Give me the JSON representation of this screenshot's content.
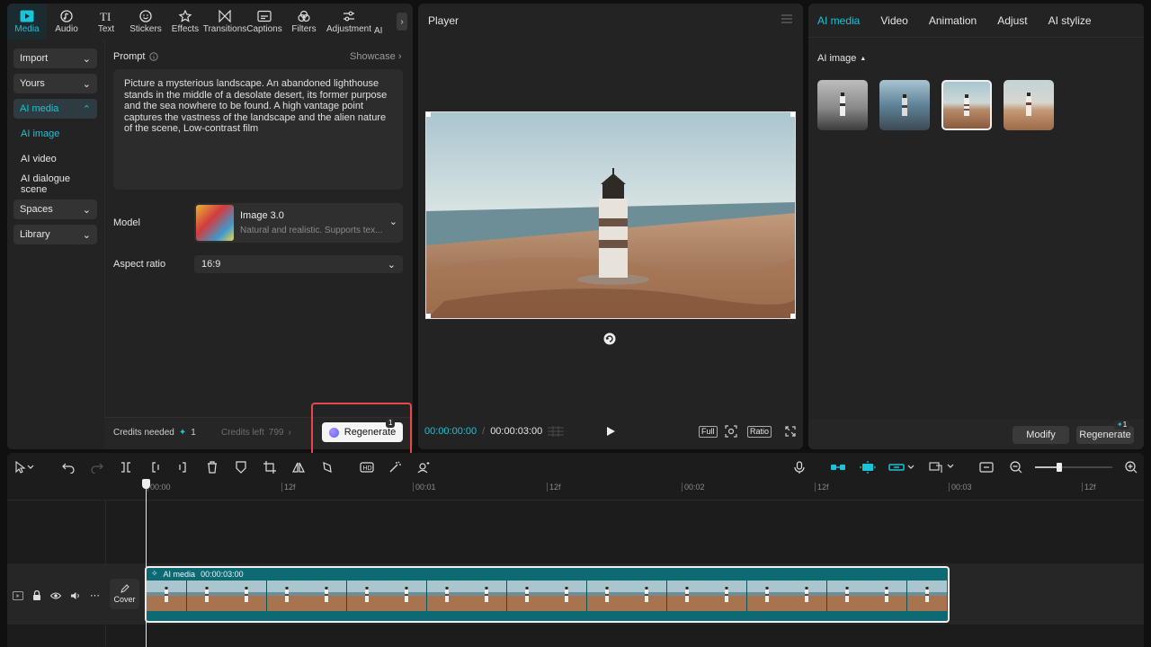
{
  "left_nav": {
    "items": [
      {
        "label": "Media",
        "icon": "media-icon",
        "active": true
      },
      {
        "label": "Audio",
        "icon": "audio-icon"
      },
      {
        "label": "Text",
        "icon": "text-icon"
      },
      {
        "label": "Stickers",
        "icon": "stickers-icon"
      },
      {
        "label": "Effects",
        "icon": "effects-icon"
      },
      {
        "label": "Transitions",
        "icon": "transitions-icon"
      },
      {
        "label": "Captions",
        "icon": "captions-icon"
      },
      {
        "label": "Filters",
        "icon": "filters-icon"
      },
      {
        "label": "Adjustment",
        "icon": "adjustment-icon"
      }
    ],
    "overflow_label": "AI"
  },
  "side_menu": {
    "import": "Import",
    "yours": "Yours",
    "ai_media": "AI media",
    "ai_image": "AI image",
    "ai_video": "AI video",
    "ai_dialogue": "AI dialogue scene",
    "spaces": "Spaces",
    "library": "Library"
  },
  "prompt": {
    "label": "Prompt",
    "showcase": "Showcase",
    "text": "Picture a mysterious landscape. An abandoned lighthouse stands in the middle of a desolate desert, its former purpose and the sea nowhere to be found. A high vantage point captures the vastness of the landscape and the alien nature of the scene, Low-contrast film"
  },
  "model": {
    "label": "Model",
    "name": "Image 3.0",
    "desc": "Natural and realistic. Supports tex..."
  },
  "aspect": {
    "label": "Aspect ratio",
    "value": "16:9"
  },
  "credits": {
    "needed_label": "Credits needed",
    "needed_value": "1",
    "left_label": "Credits left",
    "left_value": "799"
  },
  "regenerate": {
    "label": "Regenerate",
    "badge": "1"
  },
  "player": {
    "title": "Player",
    "current_time": "00:00:00:00",
    "total_time": "00:00:03:00",
    "full_label": "Full",
    "ratio_label": "Ratio"
  },
  "right_panel": {
    "tabs": [
      "AI media",
      "Video",
      "Animation",
      "Adjust",
      "AI stylize"
    ],
    "section": "AI image",
    "modify": "Modify",
    "regenerate": "Regenerate",
    "regen_badge": "1"
  },
  "timeline": {
    "ruler": [
      "00:00",
      "12f",
      "00:01",
      "12f",
      "00:02",
      "12f",
      "00:03",
      "12f"
    ],
    "clip_label": "AI media",
    "clip_duration": "00:00:03:00",
    "cover_label": "Cover"
  },
  "colors": {
    "accent": "#19c4d8",
    "highlight": "#e5484d",
    "clip": "#0e6a72"
  }
}
